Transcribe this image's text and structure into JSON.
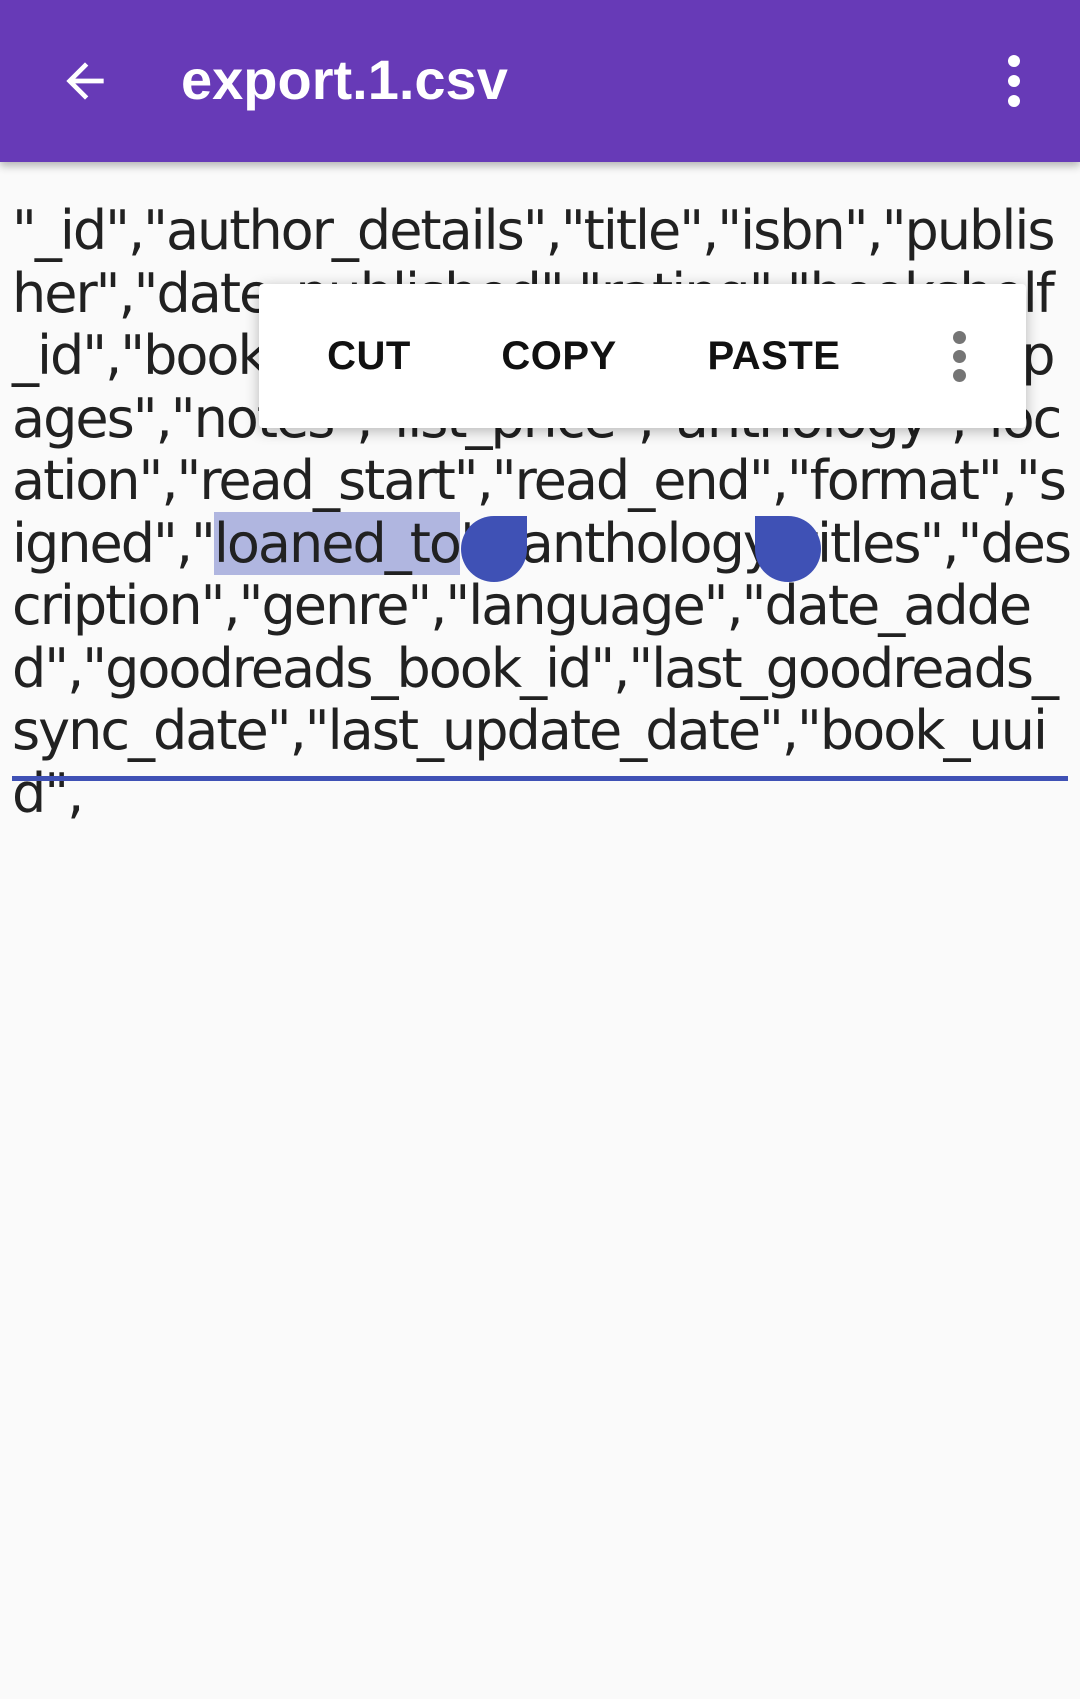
{
  "app_bar": {
    "back_icon": "arrow-back-icon",
    "title": "export.1.csv",
    "overflow_icon": "more-vert-icon",
    "color": "#673ab7"
  },
  "editor": {
    "text_before": "\"_id\",\"author_details\",\"title\",\"isbn\",\"publisher\",\"date_published\",\"rating\",\"bookshelf_id\",\"bookshelf\",\"read\",\"series_details\",\"pages\",\"notes\",\"list_price\",\"anthology\",\"location\",\"read_start\",\"read_end\",\"format\",\"signed\",\"",
    "selected_text": "loaned_to",
    "text_after": "\",\"anthology_titles\",\"description\",\"genre\",\"language\",\"date_added\",\"goodreads_book_id\",\"last_goodreads_sync_date\",\"last_update_date\",\"book_uuid\",",
    "selection_color": "#b0b6e0",
    "accent_color": "#3f51b5"
  },
  "selection_toolbar": {
    "cut_label": "CUT",
    "copy_label": "COPY",
    "paste_label": "PASTE",
    "more_icon": "more-vert-icon"
  }
}
